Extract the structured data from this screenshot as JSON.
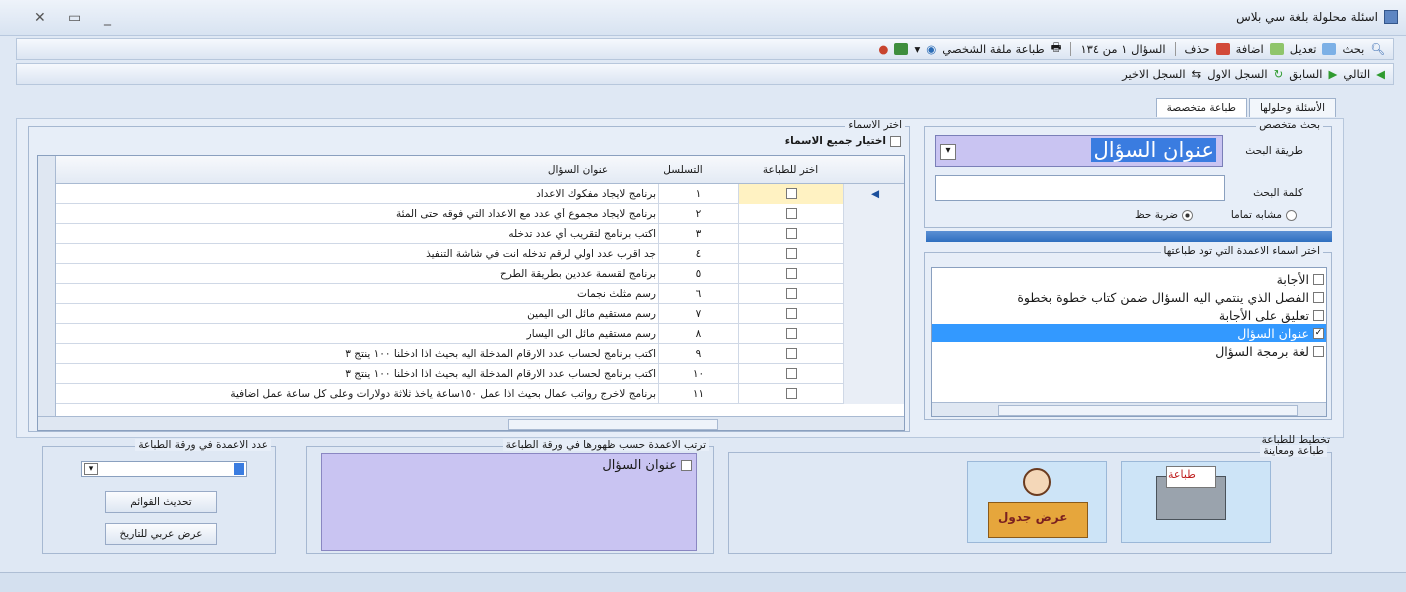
{
  "window": {
    "title": "اسئلة محلولة بلغة سي بلاس"
  },
  "toolbar1": {
    "search": "بحث",
    "edit": "تعديل",
    "add": "اضافة",
    "delete": "حذف",
    "record_counter": "السؤال ١ من ١٣٤",
    "print_file": "طباعة ملفة الشخصي"
  },
  "toolbar2": {
    "next": "التالي",
    "previous": "السابق",
    "first": "السجل الاول",
    "last": "السجل الاخير"
  },
  "tabs": [
    "الأسئلة وحلولها",
    "طباعة متخصصة"
  ],
  "search_panel": {
    "title": "بحث متخصص",
    "method_label": "طريقة البحث",
    "method_value": "عنوان السؤال",
    "keyword_label": "كلمة البحث",
    "keyword_value": "",
    "option_exact": "مشابه تماما",
    "option_partial": "ضربة حظ"
  },
  "names_panel": {
    "title": "اختر الاسماء",
    "select_all": "اختيار جميع الاسماء",
    "col_select": "اختر للطباعة",
    "col_serial": "التسلسل",
    "col_title": "عنوان السؤال",
    "rows": [
      {
        "serial": "١",
        "title": "برنامج لايجاد مفكوك الاعداد"
      },
      {
        "serial": "٢",
        "title": "برنامج لايجاد مجموع أي عدد مع الاعداد التي فوقه حتى المئة"
      },
      {
        "serial": "٣",
        "title": "اكتب برنامج  لتقريب أي عدد تدخله"
      },
      {
        "serial": "٤",
        "title": "جد اقرب عدد اولي لرقم تدخله انت في شاشة التنفيذ"
      },
      {
        "serial": "٥",
        "title": "برنامج لقسمة عددين  بطريقة الطرح"
      },
      {
        "serial": "٦",
        "title": "رسم مثلث نجمات"
      },
      {
        "serial": "٧",
        "title": "رسم مستقيم مائل الى اليمين"
      },
      {
        "serial": "٨",
        "title": "رسم مستقيم مائل الى اليسار"
      },
      {
        "serial": "٩",
        "title": "اكتب برنامج لحساب عدد الارقام المدخلة اليه بحيث اذا ادخلنا ١٠٠ ينتج ٣"
      },
      {
        "serial": "١٠",
        "title": "اكتب برنامج لحساب عدد الارقام المدخلة اليه بحيث اذا ادخلنا ١٠٠ ينتج ٣"
      },
      {
        "serial": "١١",
        "title": "برنامج لاخرج رواتب عمال بحيث اذا عمل ١٥٠ساعة ياخذ ثلاثة دولارات وعلى كل ساعة عمل اضافية"
      }
    ]
  },
  "columns_panel": {
    "title": "اختر اسماء الاعمدة التي تود طباعتها",
    "items": [
      {
        "label": "الأجابة",
        "checked": false
      },
      {
        "label": "الفصل الذي ينتمي اليه السؤال ضمن كتاب خطوة بخطوة",
        "checked": false
      },
      {
        "label": "تعليق على الأجابة",
        "checked": false
      },
      {
        "label": "عنوان السؤال",
        "checked": true
      },
      {
        "label": "لغة برمجة السؤال",
        "checked": false
      }
    ]
  },
  "count_panel": {
    "title": "عدد الاعمدة في ورقة الطباعة",
    "refresh_button": "تحديث القوائم",
    "date_button": "عرض عربي للتاريخ"
  },
  "order_panel": {
    "title": "ترتب الاعمدة حسب ظهورها في  ورقة الطباعة",
    "items": [
      {
        "label": "عنوان السؤال"
      }
    ]
  },
  "print_panel": {
    "title": "تخطيط للطباعة",
    "subtitle": "طباعة ومعاينة",
    "print_image_text": "طباعة",
    "table_image_text": "عرض جدول"
  },
  "colors": {
    "selection": "#3399ff",
    "accent_bar": "#2f6fbf",
    "lavender": "#c9c4f2"
  }
}
